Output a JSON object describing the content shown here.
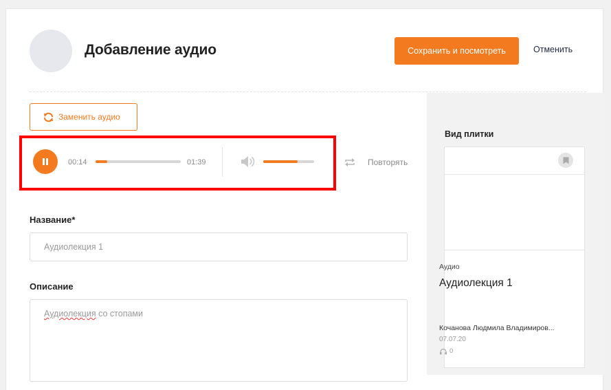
{
  "header": {
    "title": "Добавление аудио",
    "save_label": "Сохранить и посмотреть",
    "cancel_label": "Отменить"
  },
  "replace_audio": {
    "label": "Заменить аудио"
  },
  "player": {
    "state": "playing",
    "current_time": "00:14",
    "total_time": "01:39",
    "progress": 0.14,
    "volume": 0.68,
    "repeat_label": "Повторять"
  },
  "form": {
    "name_label": "Название*",
    "name_value": "Аудиолекция 1",
    "description_label": "Описание",
    "description_value_misspelled": "Аудиолекция",
    "description_value_rest": " со стопами"
  },
  "preview": {
    "heading": "Вид плитки",
    "tile": {
      "type": "Аудио",
      "title": "Аудиолекция 1",
      "author": "Кочанова Людмила Владимиров...",
      "date": "07.07.20",
      "views": "0"
    }
  },
  "colors": {
    "accent": "#f47a20",
    "highlight": "#ff0000"
  },
  "icons": {
    "replace": "refresh-icon",
    "play_state": "pause-icon",
    "volume": "volume-icon",
    "repeat": "repeat-icon",
    "bookmark": "bookmark-icon",
    "views": "headphones-icon"
  }
}
